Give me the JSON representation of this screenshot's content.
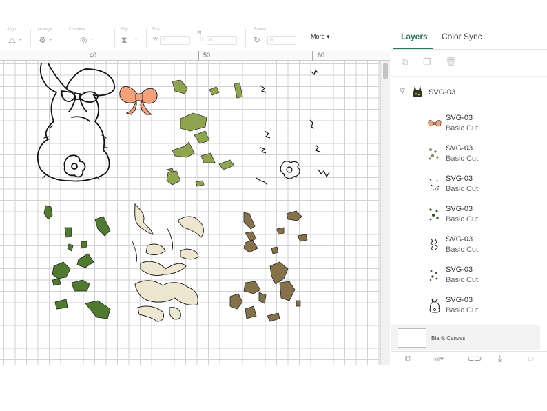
{
  "toolbar": {
    "groups": [
      "Align",
      "Arrange",
      "Combine",
      "Flip",
      "Size",
      "Rotate"
    ],
    "size_w_label": "W",
    "size_h_label": "H",
    "size_w_value": "0",
    "size_h_value": "0",
    "rotate_value": "0",
    "more_label": "More ▾"
  },
  "ruler": {
    "labels": [
      "40",
      "50",
      "60"
    ]
  },
  "panel": {
    "tabs": {
      "layers": "Layers",
      "color_sync": "Color Sync"
    },
    "icons": [
      "group-icon",
      "duplicate-icon",
      "delete-icon"
    ],
    "group": {
      "chevron": "⌵",
      "name": "SVG-03"
    },
    "layers": [
      {
        "name": "SVG-03",
        "operation": "Basic Cut",
        "thumb": "bow"
      },
      {
        "name": "SVG-03",
        "operation": "Basic Cut",
        "thumb": "green-spots"
      },
      {
        "name": "SVG-03",
        "operation": "Basic Cut",
        "thumb": "black-marks"
      },
      {
        "name": "SVG-03",
        "operation": "Basic Cut",
        "thumb": "dark-spots"
      },
      {
        "name": "SVG-03",
        "operation": "Basic Cut",
        "thumb": "crackle"
      },
      {
        "name": "SVG-03",
        "operation": "Basic Cut",
        "thumb": "brown-spots"
      },
      {
        "name": "SVG-03",
        "operation": "Basic Cut",
        "thumb": "bunny-outline"
      }
    ],
    "blank_canvas": "Blank Canvas",
    "bottom_icons": [
      "slice-icon",
      "combine-icon",
      "attach-icon",
      "flatten-icon",
      "contour-icon"
    ]
  },
  "colors": {
    "accent": "#2a7a5a",
    "bow": "#f3a07c",
    "green_spots": "#7e9a45",
    "dark_green_spots": "#4f7a30",
    "brown_spots": "#86724a",
    "crackle_fill": "#efe6d2"
  }
}
